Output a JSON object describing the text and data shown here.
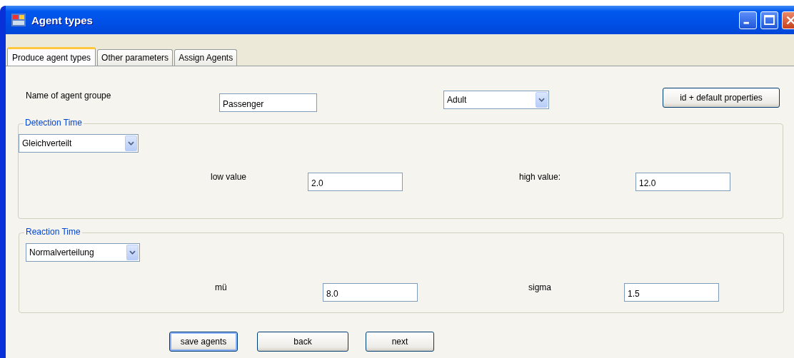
{
  "window": {
    "title": "Agent types"
  },
  "tabs": [
    {
      "label": "Produce agent types",
      "selected": true
    },
    {
      "label": "Other parameters",
      "selected": false
    },
    {
      "label": "Assign Agents",
      "selected": false
    }
  ],
  "name_row": {
    "label": "Name of agent groupe",
    "name_value": "Passenger",
    "group_value": "Adult",
    "button": "id + default properties"
  },
  "groups": [
    {
      "title": "Detection Time",
      "distribution": "Gleichverteilt",
      "params": [
        {
          "label": "low value",
          "value": "2.0"
        },
        {
          "label": "high value:",
          "value": "12.0"
        }
      ]
    },
    {
      "title": "Reaction Time",
      "distribution": "Normalverteilung",
      "params": [
        {
          "label": "mü",
          "value": "8.0"
        },
        {
          "label": "sigma",
          "value": "1.5"
        }
      ]
    }
  ],
  "buttons": [
    {
      "label": "save agents",
      "default": true
    },
    {
      "label": "back",
      "default": false
    },
    {
      "label": "next",
      "default": false
    }
  ]
}
